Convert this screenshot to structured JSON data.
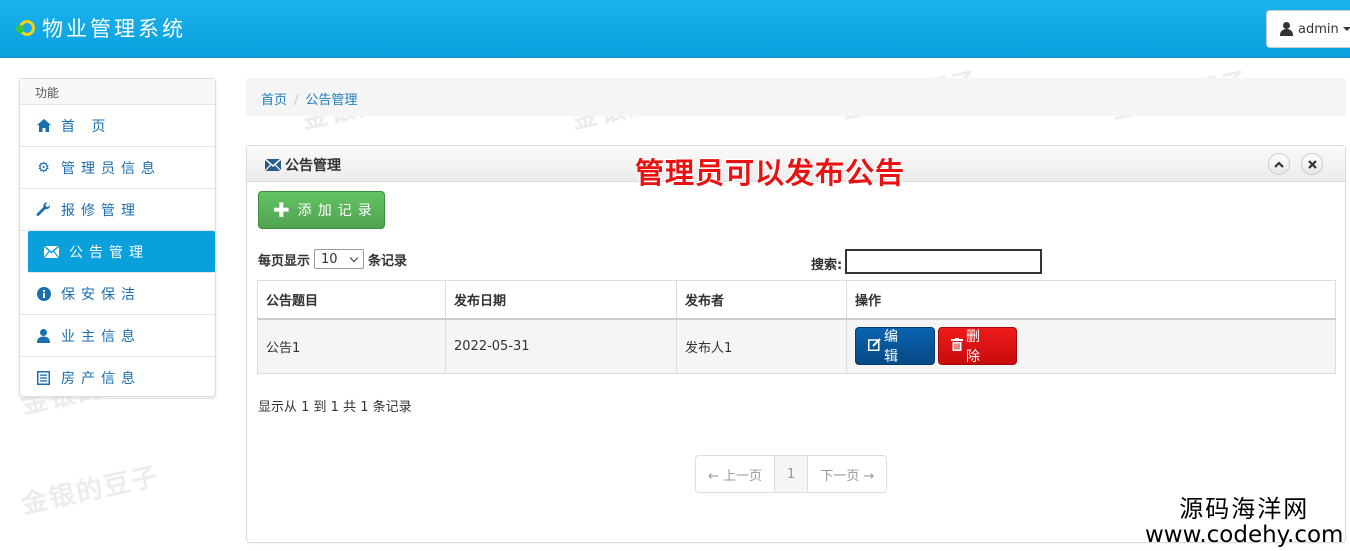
{
  "app": {
    "title": "物业管理系统",
    "user_label": "admin"
  },
  "sidebar": {
    "heading": "功能",
    "items": [
      {
        "label": "首 页",
        "icon": "home-icon"
      },
      {
        "label": "管理员信息",
        "icon": "gear-icon"
      },
      {
        "label": "报修管理",
        "icon": "wrench-icon"
      },
      {
        "label": "公告管理",
        "icon": "envelope-icon"
      },
      {
        "label": "保安保洁",
        "icon": "info-icon"
      },
      {
        "label": "业主信息",
        "icon": "user-icon"
      },
      {
        "label": "房产信息",
        "icon": "list-icon"
      }
    ],
    "active_index": 3
  },
  "breadcrumb": {
    "home": "首页",
    "sep": "/",
    "current": "公告管理"
  },
  "panel": {
    "title": "公告管理",
    "annotation": "管理员可以发布公告",
    "add_button": "添加记录",
    "length_prefix": "每页显示",
    "length_value": "10",
    "length_suffix": "条记录",
    "search_label": "搜索:",
    "search_value": "",
    "columns": [
      "公告题目",
      "发布日期",
      "发布者",
      "操作"
    ],
    "rows": [
      {
        "title": "公告1",
        "date": "2022-05-31",
        "publisher": "发布人1"
      }
    ],
    "edit_label": "编 辑",
    "delete_label": "删 除",
    "info": "显示从 1 到 1 共 1 条记录",
    "pager": {
      "prev": "← 上一页",
      "current": "1",
      "next": "下一页 →"
    }
  },
  "watermark": {
    "text": "金银的豆子",
    "source_line1": "源码海洋网",
    "source_line2": "www.codehy.com"
  },
  "colors": {
    "topbar": "#0aa0dc",
    "active_item": "#0aa0dc",
    "add_button": "#51a351",
    "edit_button": "#064a85",
    "delete_button": "#c80c0c",
    "annotation": "#e81212"
  }
}
